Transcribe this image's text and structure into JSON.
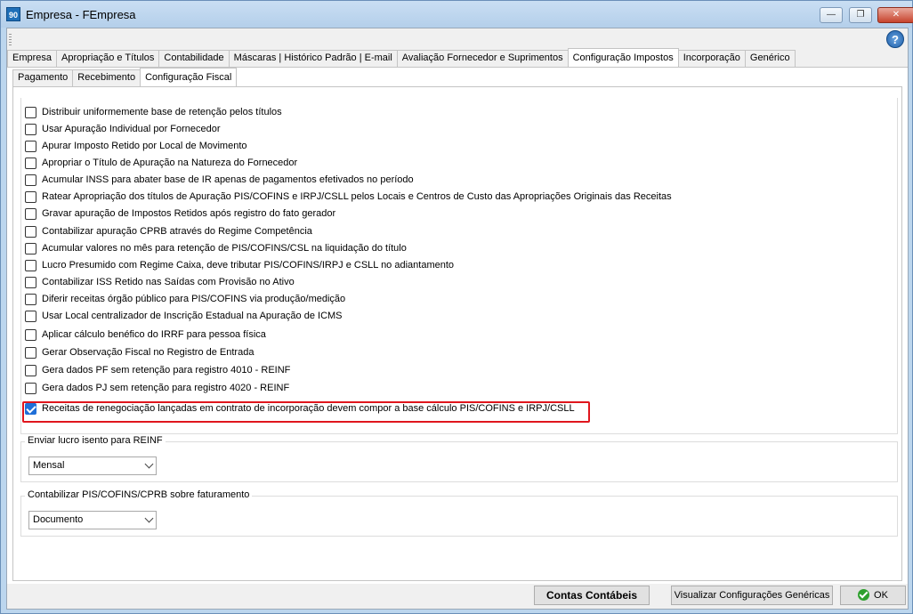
{
  "window": {
    "title": "Empresa - FEmpresa",
    "icon_label": "90",
    "buttons": {
      "minimize": "—",
      "restore": "❐",
      "close": "✕"
    }
  },
  "help_label": "?",
  "main_tabs": [
    {
      "label": "Empresa"
    },
    {
      "label": "Apropriação e Títulos"
    },
    {
      "label": "Contabilidade"
    },
    {
      "label": "Máscaras | Histórico Padrão | E-mail"
    },
    {
      "label": "Avaliação Fornecedor e Suprimentos"
    },
    {
      "label": "Configuração Impostos"
    },
    {
      "label": "Incorporação"
    },
    {
      "label": "Genérico"
    }
  ],
  "sub_tabs": [
    {
      "label": "Pagamento"
    },
    {
      "label": "Recebimento"
    },
    {
      "label": "Configuração Fiscal"
    }
  ],
  "options": [
    {
      "label": "Distribuir uniformemente base de retenção pelos títulos",
      "checked": false
    },
    {
      "label": "Usar Apuração Individual por Fornecedor",
      "checked": false
    },
    {
      "label": "Apurar Imposto Retido por Local de Movimento",
      "checked": false
    },
    {
      "label": "Apropriar o Título de Apuração na Natureza do Fornecedor",
      "checked": false
    },
    {
      "label": "Acumular INSS para abater base de IR apenas de pagamentos efetivados no período",
      "checked": false
    },
    {
      "label": "Ratear Apropriação dos títulos de Apuração PIS/COFINS e IRPJ/CSLL pelos Locais e Centros de Custo das Apropriações Originais das Receitas",
      "checked": false
    },
    {
      "label": "Gravar apuração de Impostos Retidos após registro do fato gerador",
      "checked": false
    },
    {
      "label": "Contabilizar apuração CPRB através do Regime Competência",
      "checked": false
    },
    {
      "label": "Acumular valores no mês para retenção de PIS/COFINS/CSL na liquidação do título",
      "checked": false
    },
    {
      "label": "Lucro Presumido com Regime Caixa, deve tributar PIS/COFINS/IRPJ e CSLL no adiantamento",
      "checked": false
    },
    {
      "label": "Contabilizar ISS Retido nas Saídas com Provisão no Ativo",
      "checked": false
    },
    {
      "label": "Diferir receitas órgão público para PIS/COFINS via produção/medição",
      "checked": false
    },
    {
      "label": "Usar Local centralizador de Inscrição Estadual na Apuração de ICMS",
      "checked": false
    },
    {
      "label": "Aplicar cálculo benéfico do IRRF para pessoa física",
      "checked": false
    },
    {
      "label": "Gerar Observação Fiscal no Registro de Entrada",
      "checked": false
    },
    {
      "label": "Gera dados PF sem retenção para registro 4010 - REINF",
      "checked": false
    },
    {
      "label": "Gera dados PJ sem retenção para registro 4020 - REINF",
      "checked": false
    },
    {
      "label": "Receitas de renegociação lançadas em contrato de incorporação devem compor a base cálculo PIS/COFINS e IRPJ/CSLL",
      "checked": true
    }
  ],
  "group_reinf": {
    "title": "Enviar lucro isento para REINF",
    "selected": "Mensal"
  },
  "group_faturamento": {
    "title": "Contabilizar PIS/COFINS/CPRB sobre faturamento",
    "selected": "Documento"
  },
  "footer": {
    "contas_label": "Contas Contábeis",
    "visualizar_label": "Visualizar Configurações Genéricas",
    "ok_label": "OK"
  },
  "colors": {
    "accent": "#1f6fd8",
    "highlight": "#e0161d"
  }
}
